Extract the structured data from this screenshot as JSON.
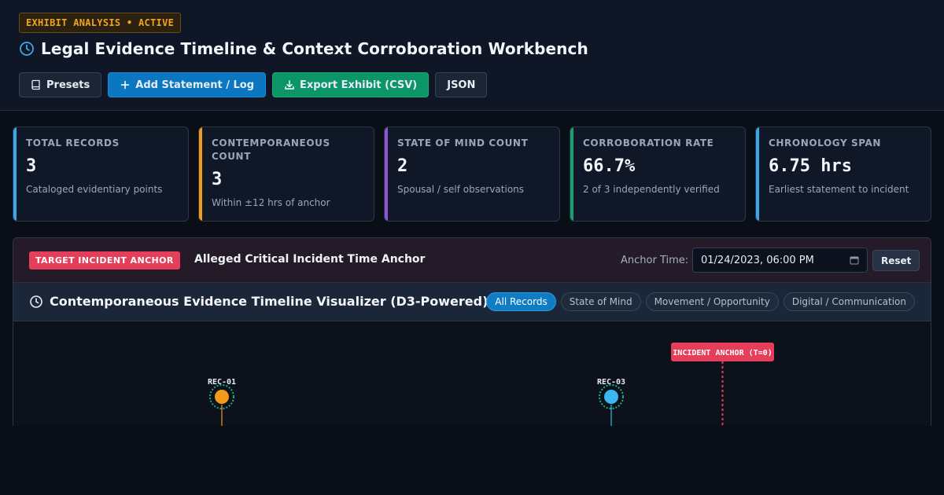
{
  "header": {
    "status_badge": "EXHIBIT ANALYSIS • ACTIVE",
    "title": "Legal Evidence Timeline & Context Corroboration Workbench",
    "title_icon": "clock-icon"
  },
  "toolbar": {
    "presets_label": "Presets",
    "add_label": "Add Statement / Log",
    "export_label": "Export Exhibit (CSV)",
    "json_label": "JSON"
  },
  "stats": [
    {
      "label": "TOTAL RECORDS",
      "value": "3",
      "sub": "Cataloged evidentiary points",
      "color": "#3aa8e8"
    },
    {
      "label": "CONTEMPORANEOUS COUNT",
      "value": "3",
      "sub": "Within ±12 hrs of anchor",
      "color": "#f29a1a"
    },
    {
      "label": "STATE OF MIND COUNT",
      "value": "2",
      "sub": "Spousal / self observations",
      "color": "#8b55d6"
    },
    {
      "label": "CORROBORATION RATE",
      "value": "66.7%",
      "sub": "2 of 3 independently verified",
      "color": "#16a06e"
    },
    {
      "label": "CHRONOLOGY SPAN",
      "value": "6.75 hrs",
      "sub": "Earliest statement to incident",
      "color": "#3aa8e8"
    }
  ],
  "anchor": {
    "badge": "TARGET INCIDENT ANCHOR",
    "title": "Alleged Critical Incident Time Anchor",
    "time_label": "Anchor Time:",
    "time_value": "01/24/2023, 06:00 PM",
    "reset_label": "Reset"
  },
  "timeline": {
    "title": "Contemporaneous Evidence Timeline Visualizer (D3-Powered)",
    "filters": [
      "All Records",
      "State of Mind",
      "Movement / Opportunity",
      "Digital / Communication"
    ],
    "active_filter": 0,
    "anchor_label": "INCIDENT ANCHOR (T=0)",
    "anchor_color": "#e53e5a",
    "records": [
      {
        "id": "REC-01",
        "color": "#f29a1a",
        "ring": "#1fae7a"
      },
      {
        "id": "REC-03",
        "color": "#3ab6f0",
        "ring": "#1fae7a"
      }
    ]
  }
}
